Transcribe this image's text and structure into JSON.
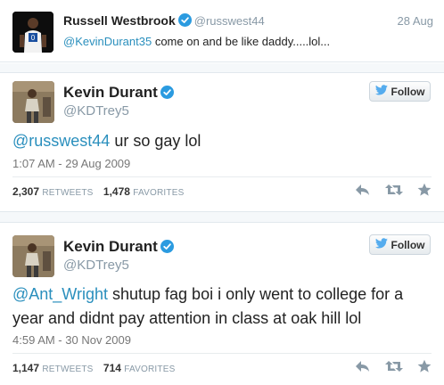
{
  "top_tweet": {
    "name": "Russell Westbrook",
    "handle": "@russwest44",
    "date": "28 Aug",
    "mention": "@KevinDurant35",
    "text": " come on and be like daddy.....lol..."
  },
  "tweets": [
    {
      "name": "Kevin Durant",
      "handle": "@KDTrey5",
      "follow_label": "Follow",
      "mention": "@russwest44",
      "text": " ur so gay lol",
      "timestamp": "1:07 AM - 29 Aug 2009",
      "retweets": "2,307",
      "retweets_label": "RETWEETS",
      "favorites": "1,478",
      "favorites_label": "FAVORITES"
    },
    {
      "name": "Kevin Durant",
      "handle": "@KDTrey5",
      "follow_label": "Follow",
      "mention": "@Ant_Wright",
      "text": " shutup fag boi i only went to college for a year and didnt pay attention in class at oak hill lol",
      "timestamp": "4:59 AM - 30 Nov 2009",
      "retweets": "1,147",
      "retweets_label": "RETWEETS",
      "favorites": "714",
      "favorites_label": "FAVORITES"
    }
  ],
  "icons": {
    "verified": "verified-badge-icon",
    "follow_bird": "twitter-bird-icon",
    "reply": "reply-icon",
    "retweet": "retweet-icon",
    "favorite": "star-icon"
  },
  "colors": {
    "link": "#2a8fbd",
    "verified": "#2b9be0",
    "muted": "#8899a6",
    "band": "#f5f8fa"
  }
}
